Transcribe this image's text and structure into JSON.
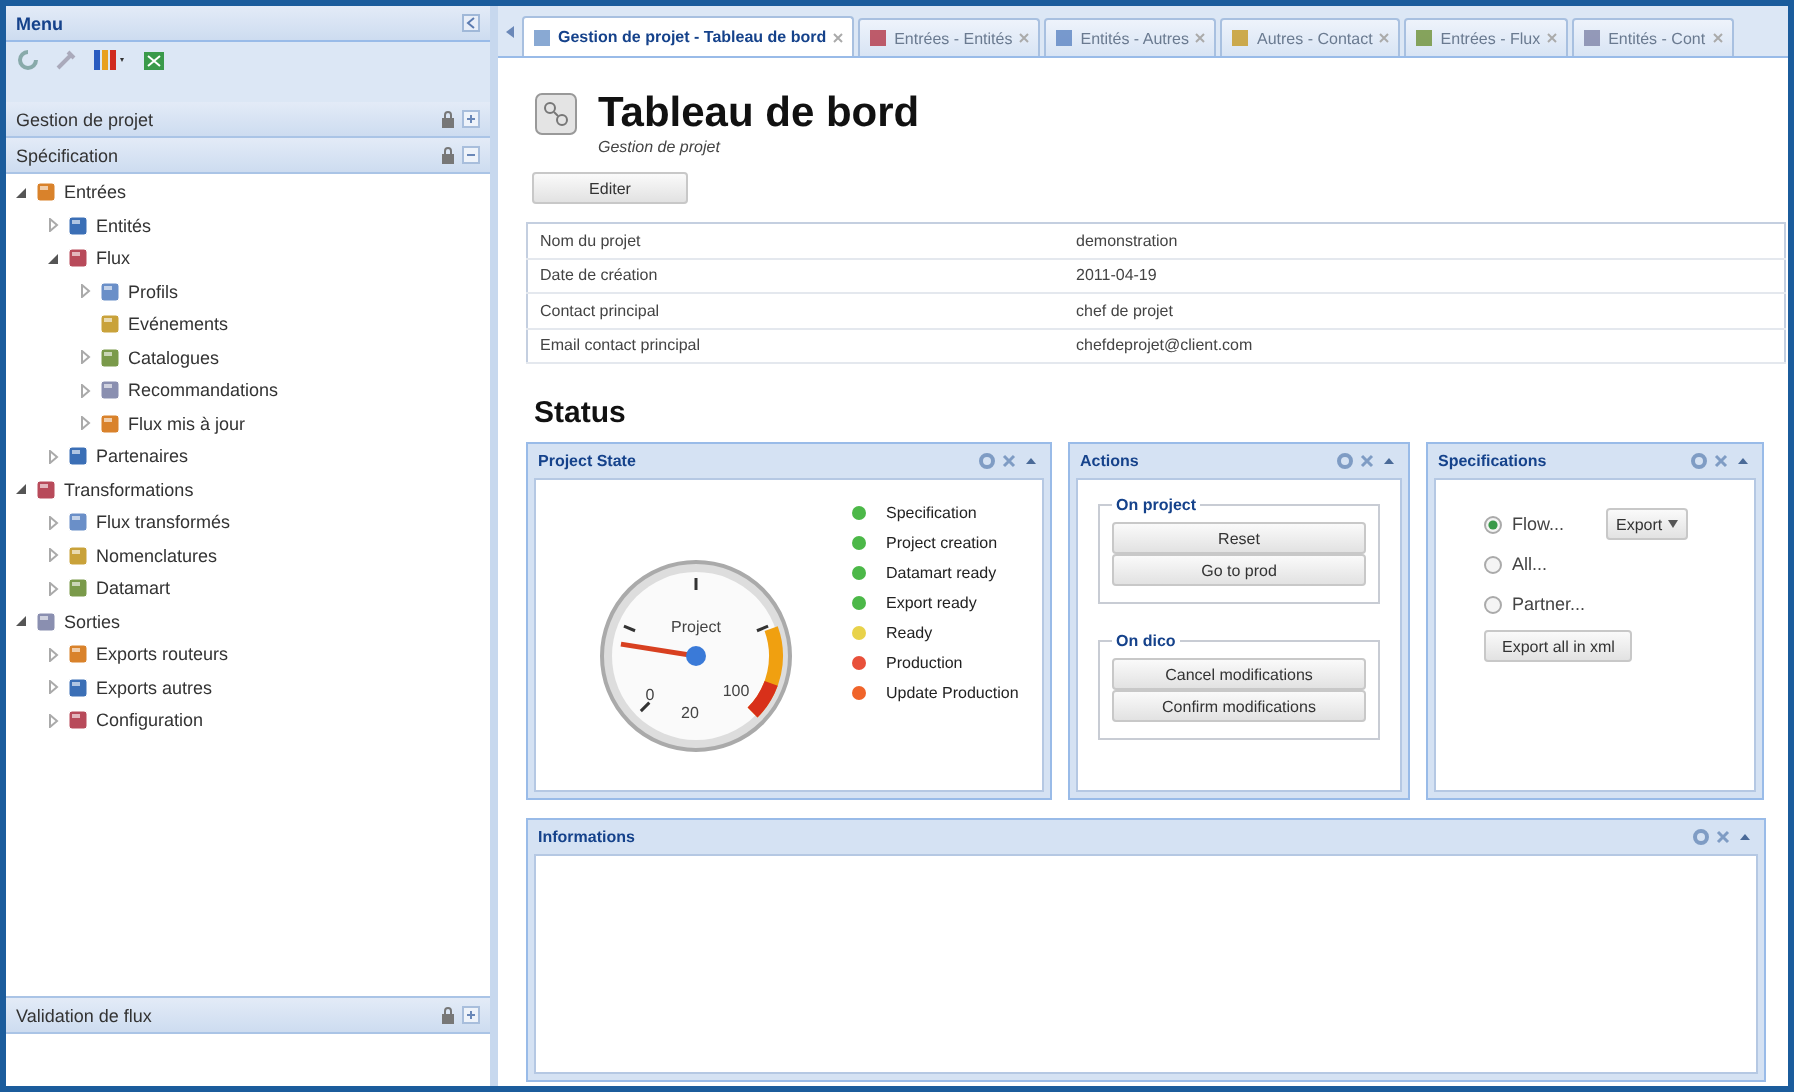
{
  "menu": {
    "title": "Menu"
  },
  "sidebar": {
    "sections": [
      {
        "label": "Gestion de projet",
        "expanded": false
      },
      {
        "label": "Spécification",
        "expanded": true
      }
    ],
    "tree": [
      {
        "label": "Entrées",
        "expanded": true,
        "children": [
          {
            "label": "Entités",
            "expanded": false
          },
          {
            "label": "Flux",
            "expanded": true,
            "children": [
              {
                "label": "Profils",
                "expanded": false
              },
              {
                "label": "Evénements"
              },
              {
                "label": "Catalogues",
                "expanded": false
              },
              {
                "label": "Recommandations",
                "expanded": false
              },
              {
                "label": "Flux mis à jour",
                "expanded": false
              }
            ]
          },
          {
            "label": "Partenaires",
            "expanded": false
          }
        ]
      },
      {
        "label": "Transformations",
        "expanded": true,
        "children": [
          {
            "label": "Flux transformés",
            "expanded": false
          },
          {
            "label": "Nomenclatures",
            "expanded": false
          },
          {
            "label": "Datamart",
            "expanded": false
          }
        ]
      },
      {
        "label": "Sorties",
        "expanded": true,
        "children": [
          {
            "label": "Exports routeurs",
            "expanded": false
          },
          {
            "label": "Exports autres",
            "expanded": false
          },
          {
            "label": "Configuration",
            "expanded": false
          }
        ]
      }
    ],
    "bottom_section": {
      "label": "Validation de flux",
      "expanded": false
    }
  },
  "tabs": [
    {
      "label": "Gestion de projet - Tableau de bord",
      "selected": true
    },
    {
      "label": "Entrées - Entités",
      "selected": false
    },
    {
      "label": "Entités - Autres",
      "selected": false
    },
    {
      "label": "Autres - Contact",
      "selected": false
    },
    {
      "label": "Entrées - Flux",
      "selected": false
    },
    {
      "label": "Entités - Cont",
      "selected": false
    }
  ],
  "page": {
    "title": "Tableau de bord",
    "subtitle": "Gestion de projet",
    "edit_button": "Editer"
  },
  "project_info": [
    {
      "label": "Nom du projet",
      "value": "demonstration"
    },
    {
      "label": "Date de création",
      "value": "2011-04-19"
    },
    {
      "label": "Contact principal",
      "value": "chef de projet"
    },
    {
      "label": "Email contact principal",
      "value": "chefdeprojet@client.com"
    }
  ],
  "status_heading": "Status",
  "project_state": {
    "title": "Project State",
    "gauge": {
      "label": "Project",
      "min": "0",
      "max": "100",
      "reading": "20",
      "level": 0.2
    },
    "steps": [
      {
        "label": "Specification",
        "color": "#4cb848"
      },
      {
        "label": "Project creation",
        "color": "#4cb848"
      },
      {
        "label": "Datamart ready",
        "color": "#4cb848"
      },
      {
        "label": "Export ready",
        "color": "#4cb848"
      },
      {
        "label": "Ready",
        "color": "#e8d24a"
      },
      {
        "label": "Production",
        "color": "#e8503a"
      },
      {
        "label": "Update Production",
        "color": "#f0642a"
      }
    ]
  },
  "actions": {
    "title": "Actions",
    "groups": [
      {
        "legend": "On project",
        "buttons": [
          "Reset",
          "Go to prod"
        ]
      },
      {
        "legend": "On dico",
        "buttons": [
          "Cancel modifications",
          "Confirm modifications"
        ]
      }
    ]
  },
  "specifications": {
    "title": "Specifications",
    "options": [
      {
        "label": "Flow...",
        "selected": true
      },
      {
        "label": "All...",
        "selected": false
      },
      {
        "label": "Partner...",
        "selected": false
      }
    ],
    "export_menu": "Export",
    "export_all_button": "Export all in xml"
  },
  "informations": {
    "title": "Informations"
  }
}
